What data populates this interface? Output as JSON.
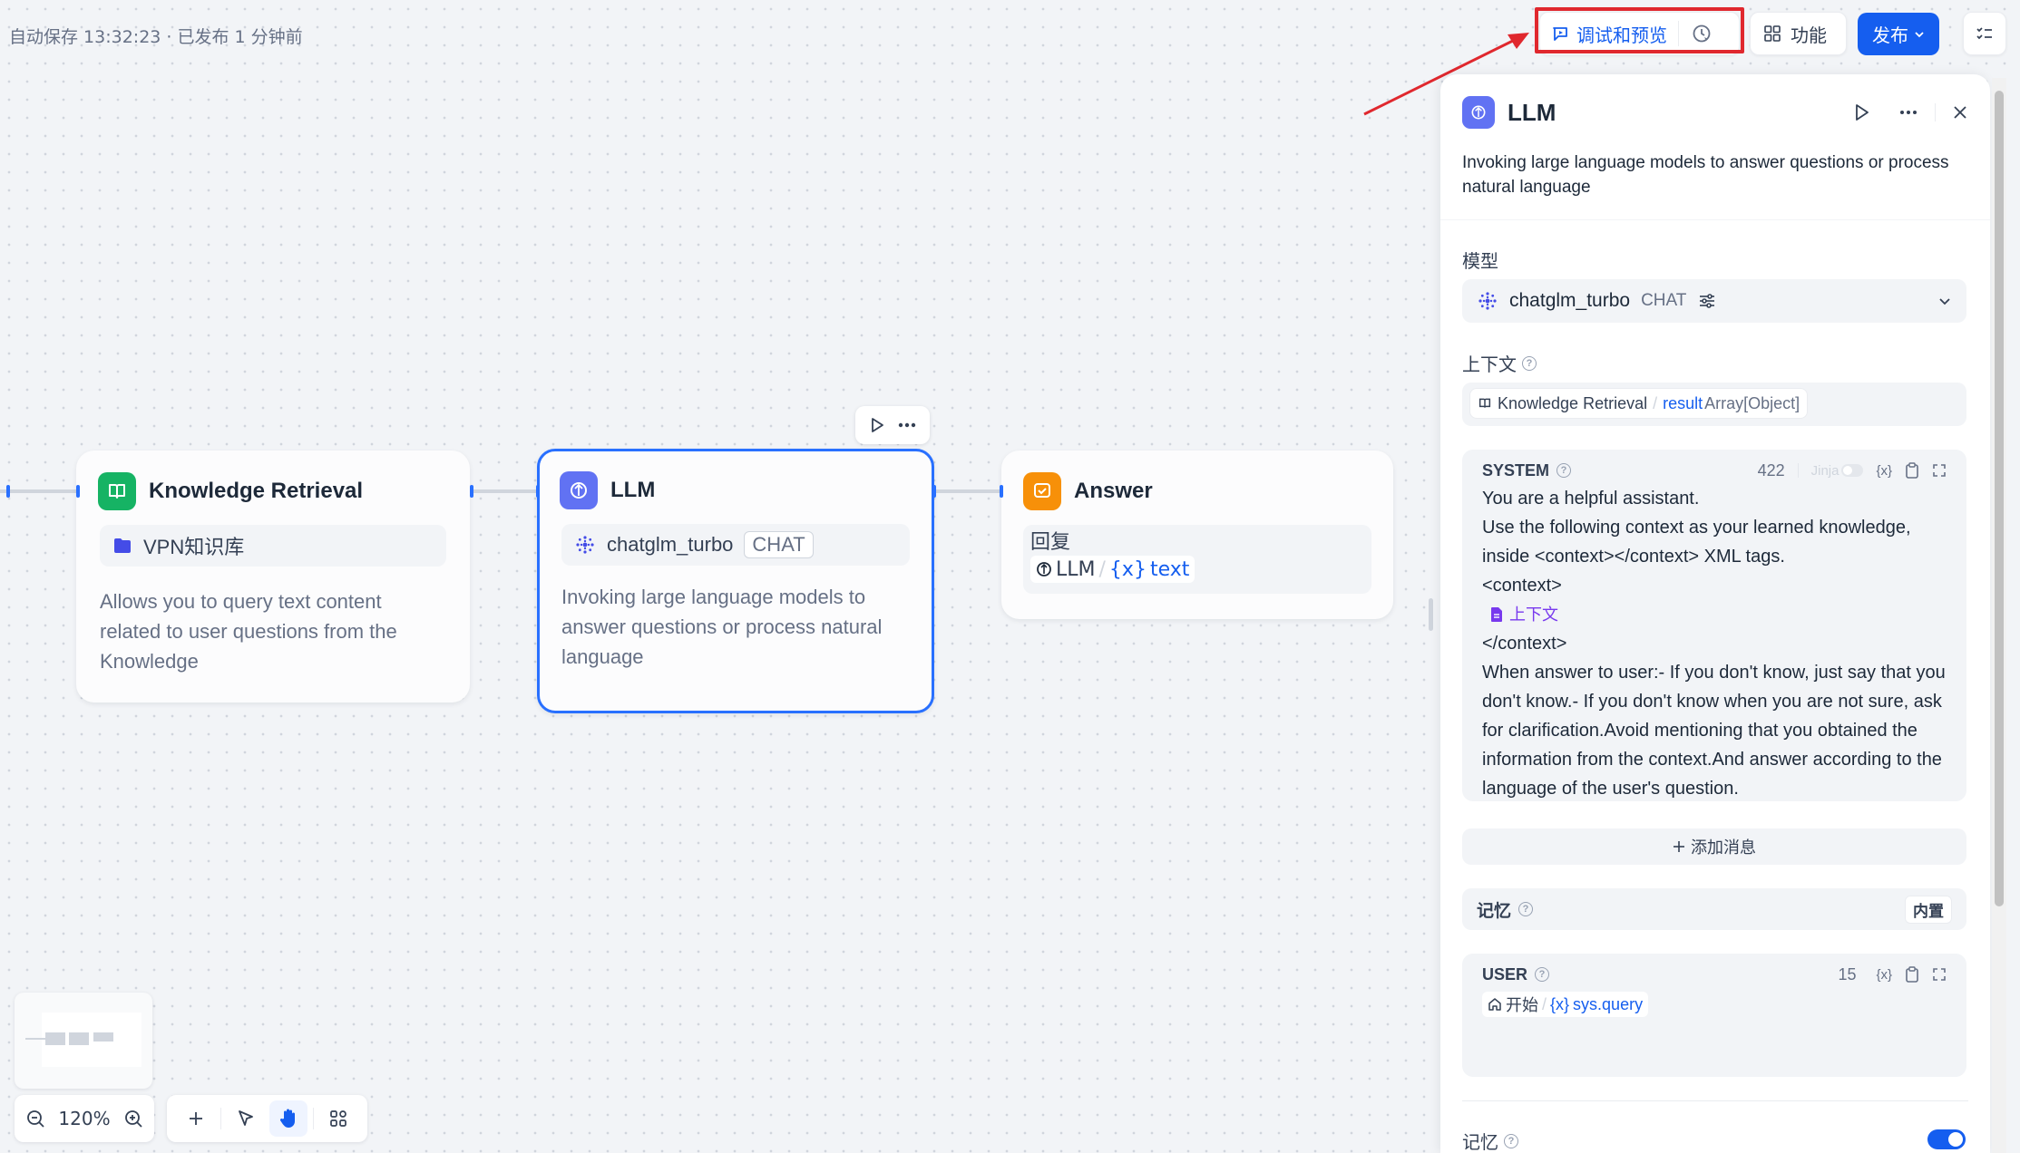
{
  "header": {
    "status": "自动保存 13:32:23 · 已发布 1 分钟前",
    "debug_label": "调试和预览",
    "features_label": "功能",
    "publish_label": "发布"
  },
  "canvas": {
    "nodes": {
      "knowledge": {
        "title": "Knowledge Retrieval",
        "dataset": "VPN知识库",
        "description": "Allows you to query text content related to user questions from the Knowledge"
      },
      "llm": {
        "title": "LLM",
        "model": "chatglm_turbo",
        "tag": "CHAT",
        "description": "Invoking large language models to answer questions or process natural language"
      },
      "answer": {
        "title": "Answer",
        "label": "回复",
        "var_node": "LLM",
        "var_sep": "/",
        "var_name": "text"
      }
    },
    "zoom": "120%"
  },
  "panel": {
    "title": "LLM",
    "description": "Invoking large language models to answer questions or process natural language",
    "model_label": "模型",
    "model_name": "chatglm_turbo",
    "model_tag": "CHAT",
    "context_label": "上下文",
    "context_node": "Knowledge Retrieval",
    "context_sep": "/",
    "context_var": "result",
    "context_type": "Array[Object]",
    "system": {
      "role": "SYSTEM",
      "count": "422",
      "jinja": "Jinja",
      "line1": "You are a helpful assistant.",
      "line2": "Use the following context as your learned knowledge, inside <context></context> XML tags.",
      "line3": "<context>",
      "ctx_chip": "上下文",
      "line4": "</context>",
      "line5": "When answer to user:- If you don't know, just say that you don't know.- If you don't know when you are not sure, ask for clarification.Avoid mentioning that you obtained the information from the context.And answer according to the language of the user's question."
    },
    "add_message": "添加消息",
    "memory_label": "记忆",
    "memory_builtin": "内置",
    "user": {
      "role": "USER",
      "count": "15",
      "var_node": "开始",
      "var_sep": "/",
      "var_name": "sys.query"
    },
    "memory_bottom_label": "记忆"
  },
  "colors": {
    "accent": "#155eef",
    "knowledge_icon": "#16b364",
    "llm_icon": "#6172f3",
    "answer_icon": "#f79009",
    "highlight": "#e0282e"
  }
}
